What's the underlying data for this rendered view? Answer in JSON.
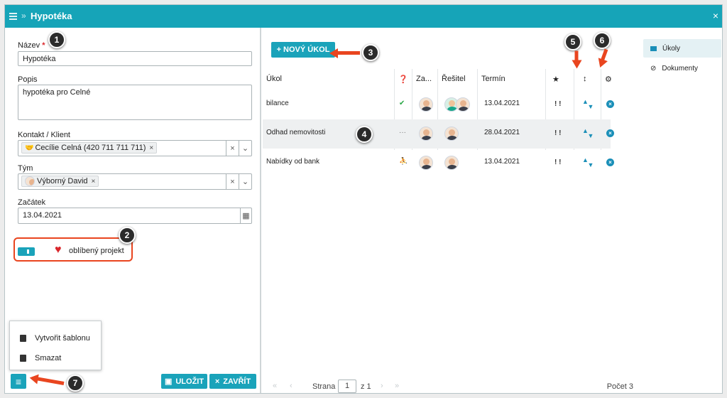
{
  "window": {
    "title": "Hypotéka",
    "close_glyph": "×",
    "breadcrumb_glyph": "»"
  },
  "form": {
    "name": {
      "label": "Název",
      "required_mark": "*",
      "value": "Hypotéka"
    },
    "description": {
      "label": "Popis",
      "value": "hypotéka pro Celné"
    },
    "contact": {
      "label": "Kontakt / Klient",
      "tag": "Cecílie Celná (420 711 711 711)",
      "tag_icon": "handshake-icon"
    },
    "team": {
      "label": "Tým",
      "tag": "Výborný David"
    },
    "start": {
      "label": "Začátek",
      "value": "13.04.2021"
    },
    "favorite": {
      "label": "oblíbený projekt",
      "enabled": true
    }
  },
  "menu": {
    "items": [
      {
        "label": "Vytvořit šablonu",
        "icon": "file-template-icon"
      },
      {
        "label": "Smazat",
        "icon": "trash-icon"
      }
    ]
  },
  "footer": {
    "save_label": "ULOŽIT",
    "close_label": "ZAVŘÍT",
    "menu_glyph": "≡"
  },
  "tasks": {
    "new_button": "+ NOVÝ ÚKOL",
    "headers": {
      "task": "Úkol",
      "status": "❓",
      "assignee": "Za...",
      "solver": "Řešitel",
      "deadline": "Termín",
      "priority": "★",
      "order": "↕",
      "settings": "⚙"
    },
    "rows": [
      {
        "task": "bilance",
        "status": "✔",
        "deadline": "13.04.2021",
        "priority": "! !"
      },
      {
        "task": "Odhad nemovitosti",
        "status": "···",
        "deadline": "28.04.2021",
        "priority": "! !"
      },
      {
        "task": "Nabídky od bank",
        "status": "⛹",
        "deadline": "13.04.2021",
        "priority": "! !"
      }
    ],
    "pager": {
      "page_label": "Strana",
      "page": "1",
      "of_label": "z 1",
      "count_label": "Počet 3"
    }
  },
  "sidebar": {
    "items": [
      {
        "label": "Úkoly",
        "icon": "list-icon",
        "active": true
      },
      {
        "label": "Dokumenty",
        "icon": "paperclip-icon",
        "active": false
      }
    ]
  },
  "callouts": [
    "1",
    "2",
    "3",
    "4",
    "5",
    "6",
    "7"
  ],
  "colors": {
    "accent": "#16a4b8",
    "callout": "#e9451f",
    "danger": "#d9262b",
    "link": "#1a8fb8"
  }
}
